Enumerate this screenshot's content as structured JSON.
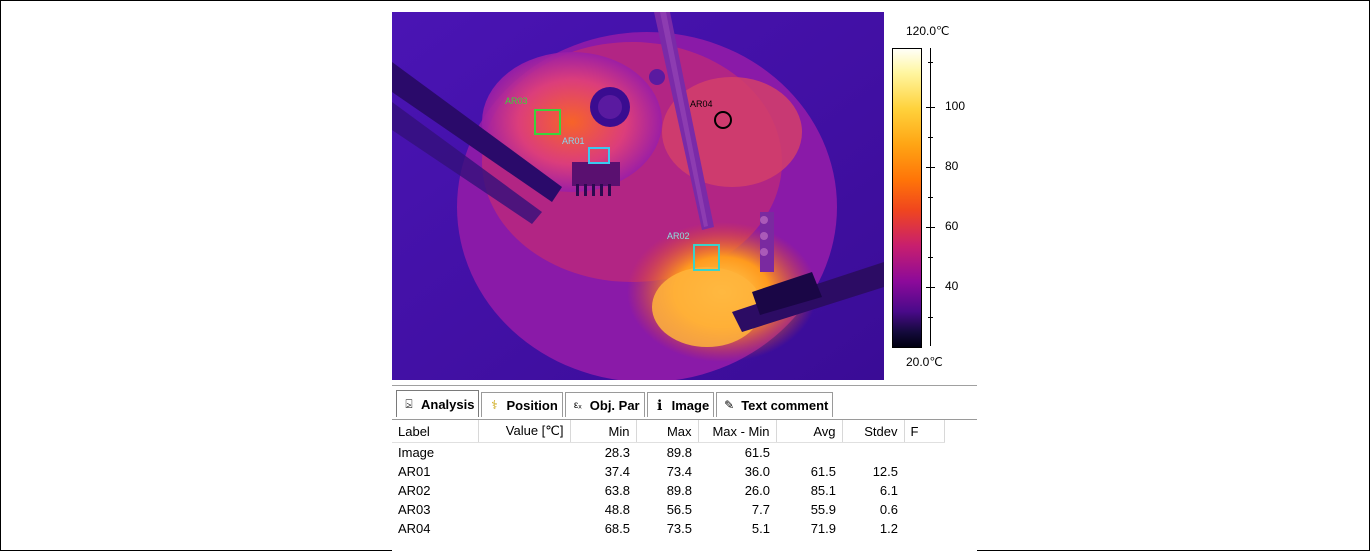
{
  "thermal": {
    "rois": [
      {
        "label": "AR03",
        "shape": "rect",
        "color": "#3cd23c"
      },
      {
        "label": "AR01",
        "shape": "rect",
        "color": "#3cc8f0"
      },
      {
        "label": "AR04",
        "shape": "circle",
        "color": "#000000"
      },
      {
        "label": "AR02",
        "shape": "rect",
        "color": "#3cd2c8"
      }
    ]
  },
  "scale": {
    "max_label": "120.0℃",
    "min_label": "20.0℃",
    "ticks": [
      "100",
      "80",
      "60",
      "40"
    ]
  },
  "tabs": [
    {
      "label": "Analysis",
      "icon": "analysis-icon",
      "glyph": "⍄"
    },
    {
      "label": "Position",
      "icon": "position-icon",
      "glyph": "⚕"
    },
    {
      "label": "Obj. Par",
      "icon": "object-parameter-icon",
      "glyph": "εₓ"
    },
    {
      "label": "Image",
      "icon": "info-icon",
      "glyph": "ℹ"
    },
    {
      "label": "Text comment",
      "icon": "text-comment-icon",
      "glyph": "✎"
    }
  ],
  "table": {
    "columns": [
      "Label",
      "Value [℃]",
      "Min",
      "Max",
      "Max - Min",
      "Avg",
      "Stdev",
      "F"
    ],
    "rows": [
      [
        "Image",
        "",
        "28.3",
        "89.8",
        "61.5",
        "",
        "",
        ""
      ],
      [
        "AR01",
        "",
        "37.4",
        "73.4",
        "36.0",
        "61.5",
        "12.5",
        ""
      ],
      [
        "AR02",
        "",
        "63.8",
        "89.8",
        "26.0",
        "85.1",
        "6.1",
        ""
      ],
      [
        "AR03",
        "",
        "48.8",
        "56.5",
        "7.7",
        "55.9",
        "0.6",
        ""
      ],
      [
        "AR04",
        "",
        "68.5",
        "73.5",
        "5.1",
        "71.9",
        "1.2",
        ""
      ]
    ]
  }
}
